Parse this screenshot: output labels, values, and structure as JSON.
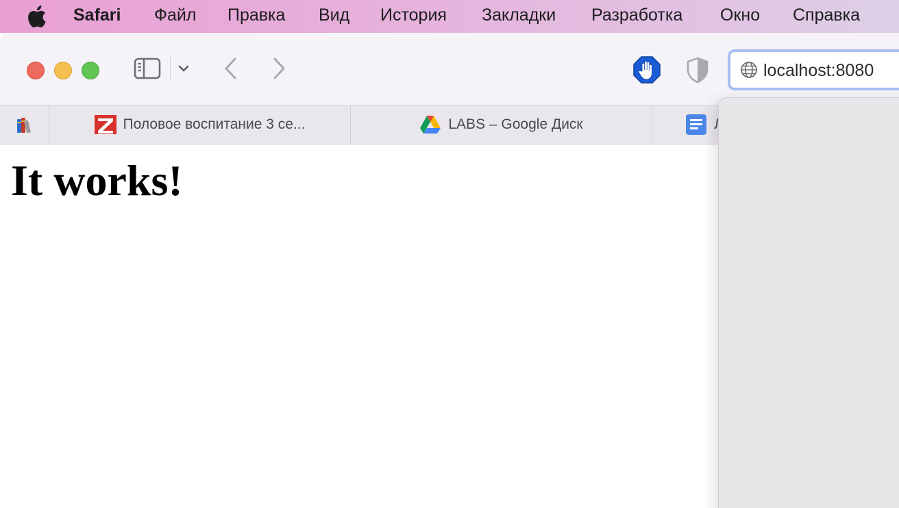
{
  "menubar": {
    "app_name": "Safari",
    "items": [
      "Файл",
      "Правка",
      "Вид",
      "История",
      "Закладки",
      "Разработка",
      "Окно",
      "Справка"
    ]
  },
  "toolbar": {
    "address": "localhost:8080"
  },
  "tabs": [
    {
      "title": "Половое воспитание 3 се...",
      "icon": "z-logo-icon"
    },
    {
      "title": "LABS – Google Диск",
      "icon": "google-drive-icon"
    },
    {
      "title": "Л",
      "icon": "google-docs-icon"
    }
  ],
  "page": {
    "heading": "It works!"
  },
  "colors": {
    "accent": "#a7bff3",
    "close": "#ed6a5e",
    "minimize": "#f5bf4f",
    "zoom": "#61c554"
  }
}
